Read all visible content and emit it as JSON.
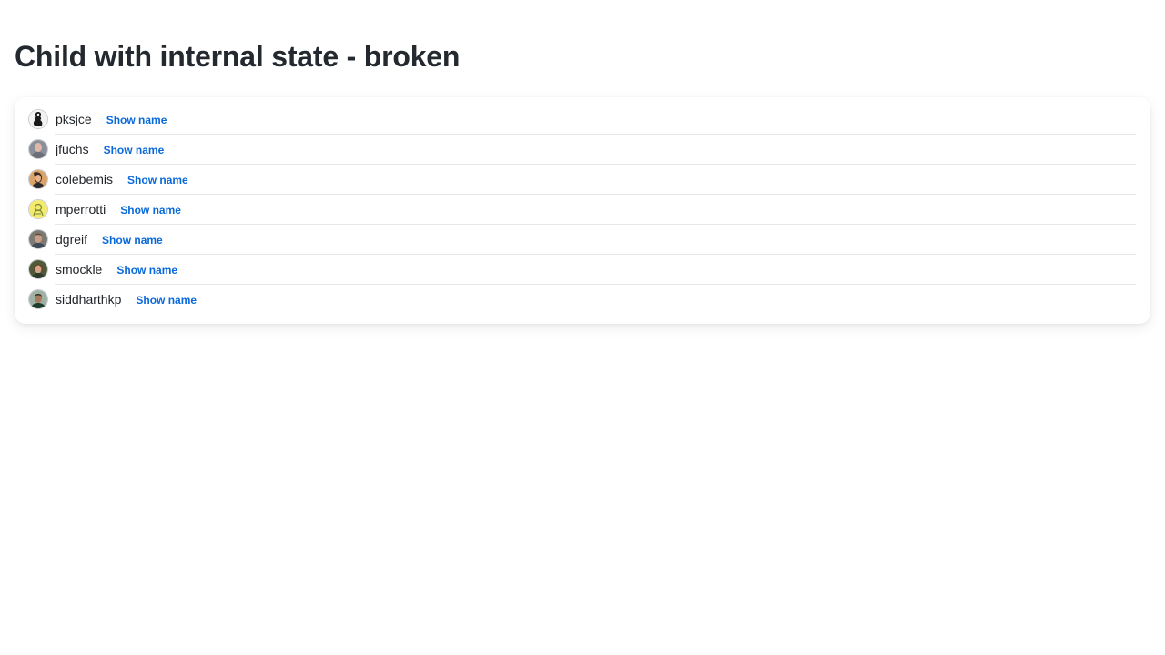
{
  "page": {
    "title": "Child with internal state - broken"
  },
  "users": [
    {
      "username": "pksjce",
      "action_label": "Show name",
      "avatar_icon": "avatar-pksjce-icon",
      "avatar_colors": {
        "bg": "#f2f2f2",
        "fg": "#1a1a1a"
      }
    },
    {
      "username": "jfuchs",
      "action_label": "Show name",
      "avatar_icon": "avatar-jfuchs-icon",
      "avatar_colors": {
        "bg": "#8a8f99",
        "fg": "#e0b7a8"
      }
    },
    {
      "username": "colebemis",
      "action_label": "Show name",
      "avatar_icon": "avatar-colebemis-icon",
      "avatar_colors": {
        "bg": "#d9a36a",
        "fg": "#3a2a22"
      }
    },
    {
      "username": "mperrotti",
      "action_label": "Show name",
      "avatar_icon": "avatar-mperrotti-icon",
      "avatar_colors": {
        "bg": "#f3ea6b",
        "fg": "#7b8a3a"
      }
    },
    {
      "username": "dgreif",
      "action_label": "Show name",
      "avatar_icon": "avatar-dgreif-icon",
      "avatar_colors": {
        "bg": "#7d7a72",
        "fg": "#c99d86"
      }
    },
    {
      "username": "smockle",
      "action_label": "Show name",
      "avatar_icon": "avatar-smockle-icon",
      "avatar_colors": {
        "bg": "#4e5a3a",
        "fg": "#d2a489"
      }
    },
    {
      "username": "siddharthkp",
      "action_label": "Show name",
      "avatar_icon": "avatar-siddharthkp-icon",
      "avatar_colors": {
        "bg": "#9fb0a4",
        "fg": "#3a2f28"
      }
    }
  ],
  "theme": {
    "link_color": "#0969da",
    "divider_color": "#e4e6e8"
  }
}
